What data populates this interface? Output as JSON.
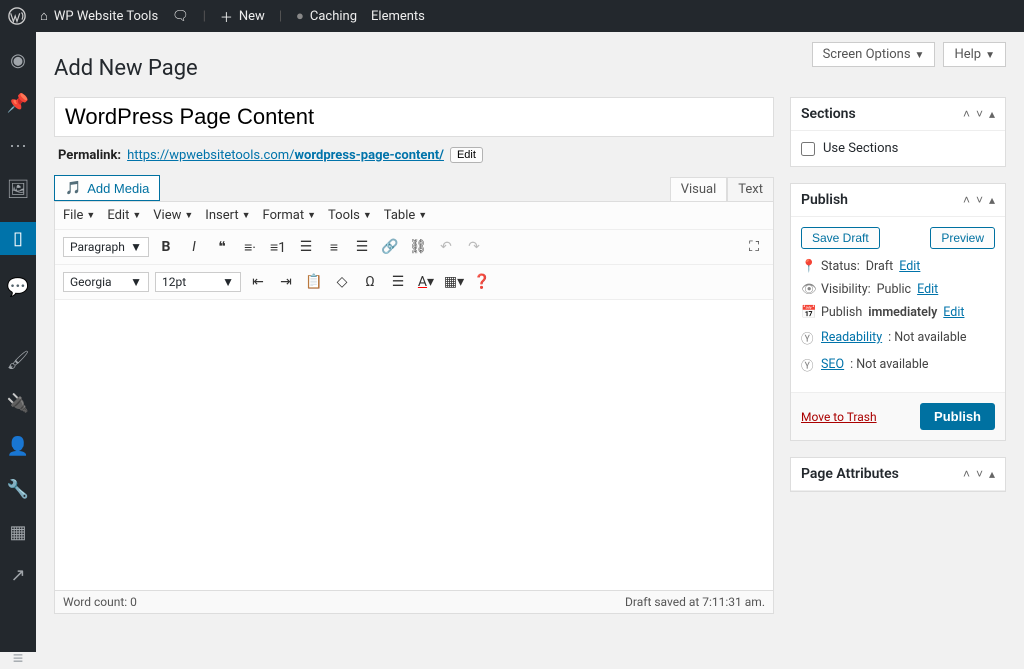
{
  "adminbar": {
    "site_name": "WP Website Tools",
    "new_label": "New",
    "caching_label": "Caching",
    "elements_label": "Elements"
  },
  "topright": {
    "screen_options": "Screen Options",
    "help": "Help"
  },
  "page": {
    "heading": "Add New Page",
    "title_value": "WordPress Page Content",
    "permalink_label": "Permalink:",
    "permalink_base": "https://wpwebsitetools.com/",
    "permalink_slug": "wordpress-page-content/",
    "permalink_edit": "Edit",
    "add_media": "Add Media",
    "tab_visual": "Visual",
    "tab_text": "Text"
  },
  "menus": {
    "file": "File",
    "edit": "Edit",
    "view": "View",
    "insert": "Insert",
    "format": "Format",
    "tools": "Tools",
    "table": "Table"
  },
  "toolbar": {
    "para": "Paragraph",
    "font": "Georgia",
    "size": "12pt"
  },
  "status": {
    "wordcount": "Word count: 0",
    "saved": "Draft saved at 7:11:31 am."
  },
  "sections_box": {
    "title": "Sections",
    "use_sections": "Use Sections"
  },
  "publish": {
    "title": "Publish",
    "save_draft": "Save Draft",
    "preview": "Preview",
    "status_label": "Status:",
    "status_value": "Draft",
    "edit": "Edit",
    "visibility_label": "Visibility:",
    "visibility_value": "Public",
    "publish_label": "Publish",
    "publish_value": "immediately",
    "readability_label": "Readability",
    "seo_label": "SEO",
    "not_available": ": Not available",
    "trash": "Move to Trash",
    "publish_btn": "Publish"
  },
  "attrs": {
    "title": "Page Attributes"
  }
}
